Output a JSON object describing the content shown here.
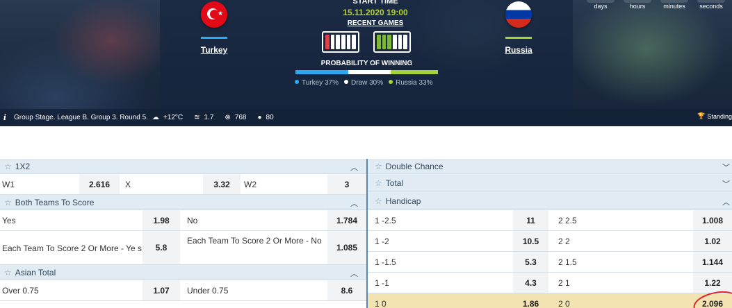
{
  "match": {
    "home_team": "Turkey",
    "away_team": "Russia",
    "start_time_label": "START TIME",
    "start_datetime": "15.11.2020 19:00",
    "recent_games_label": "RECENT GAMES",
    "probability_label": "PROBABILITY OF WINNING",
    "probabilities": [
      {
        "label": "Turkey 37%",
        "value": 0.37,
        "color": "#2ea8f0"
      },
      {
        "label": "Draw 30%",
        "value": 0.3,
        "color": "#ffffff"
      },
      {
        "label": "Russia 33%",
        "value": 0.33,
        "color": "#a6d23a"
      }
    ],
    "home_form": [
      "loss",
      "draw",
      "draw",
      "draw",
      "draw",
      "draw"
    ],
    "away_form": [
      "win",
      "win",
      "win",
      "draw",
      "draw",
      "draw"
    ],
    "home_color": "#2ea8f0",
    "away_color": "#a6d23a"
  },
  "countdown": {
    "days": "days",
    "hours": "hours",
    "minutes": "minutes",
    "seconds": "seconds"
  },
  "info": {
    "stage": "Group Stage. League B. Group 3. Round 5.",
    "temperature": "+12°C",
    "wind": "1.7",
    "pressure": "768",
    "humidity": "80",
    "standings": "Standing"
  },
  "markets": {
    "one_x_two": {
      "title": "1X2",
      "outcomes": [
        {
          "label": "W1",
          "odds": "2.616"
        },
        {
          "label": "X",
          "odds": "3.32"
        },
        {
          "label": "W2",
          "odds": "3"
        }
      ]
    },
    "btts": {
      "title": "Both Teams To Score",
      "rows": [
        [
          {
            "label": "Yes",
            "odds": "1.98"
          },
          {
            "label": "No",
            "odds": "1.784"
          }
        ],
        [
          {
            "label": "Each Team To Score 2 Or More - Ye s",
            "odds": "5.8"
          },
          {
            "label": "Each Team To Score 2 Or More - No",
            "odds": "1.085"
          }
        ]
      ]
    },
    "asian_total": {
      "title": "Asian Total",
      "rows": [
        [
          {
            "label": "Over 0.75",
            "odds": "1.07"
          },
          {
            "label": "Under 0.75",
            "odds": "8.6"
          }
        ]
      ]
    },
    "double_chance": {
      "title": "Double Chance"
    },
    "total": {
      "title": "Total"
    },
    "handicap": {
      "title": "Handicap",
      "rows": [
        [
          {
            "label": "1 -2.5",
            "odds": "11"
          },
          {
            "label": "2 2.5",
            "odds": "1.008"
          }
        ],
        [
          {
            "label": "1 -2",
            "odds": "10.5"
          },
          {
            "label": "2 2",
            "odds": "1.02"
          }
        ],
        [
          {
            "label": "1 -1.5",
            "odds": "5.3"
          },
          {
            "label": "2 1.5",
            "odds": "1.144"
          }
        ],
        [
          {
            "label": "1 -1",
            "odds": "4.3"
          },
          {
            "label": "2 1",
            "odds": "1.22"
          }
        ],
        [
          {
            "label": "1 0",
            "odds": "1.86"
          },
          {
            "label": "2 0",
            "odds": "2.096"
          }
        ]
      ]
    }
  },
  "icons": {
    "star": "☆",
    "chevron_up": "^",
    "chevron_down": "⌄"
  }
}
